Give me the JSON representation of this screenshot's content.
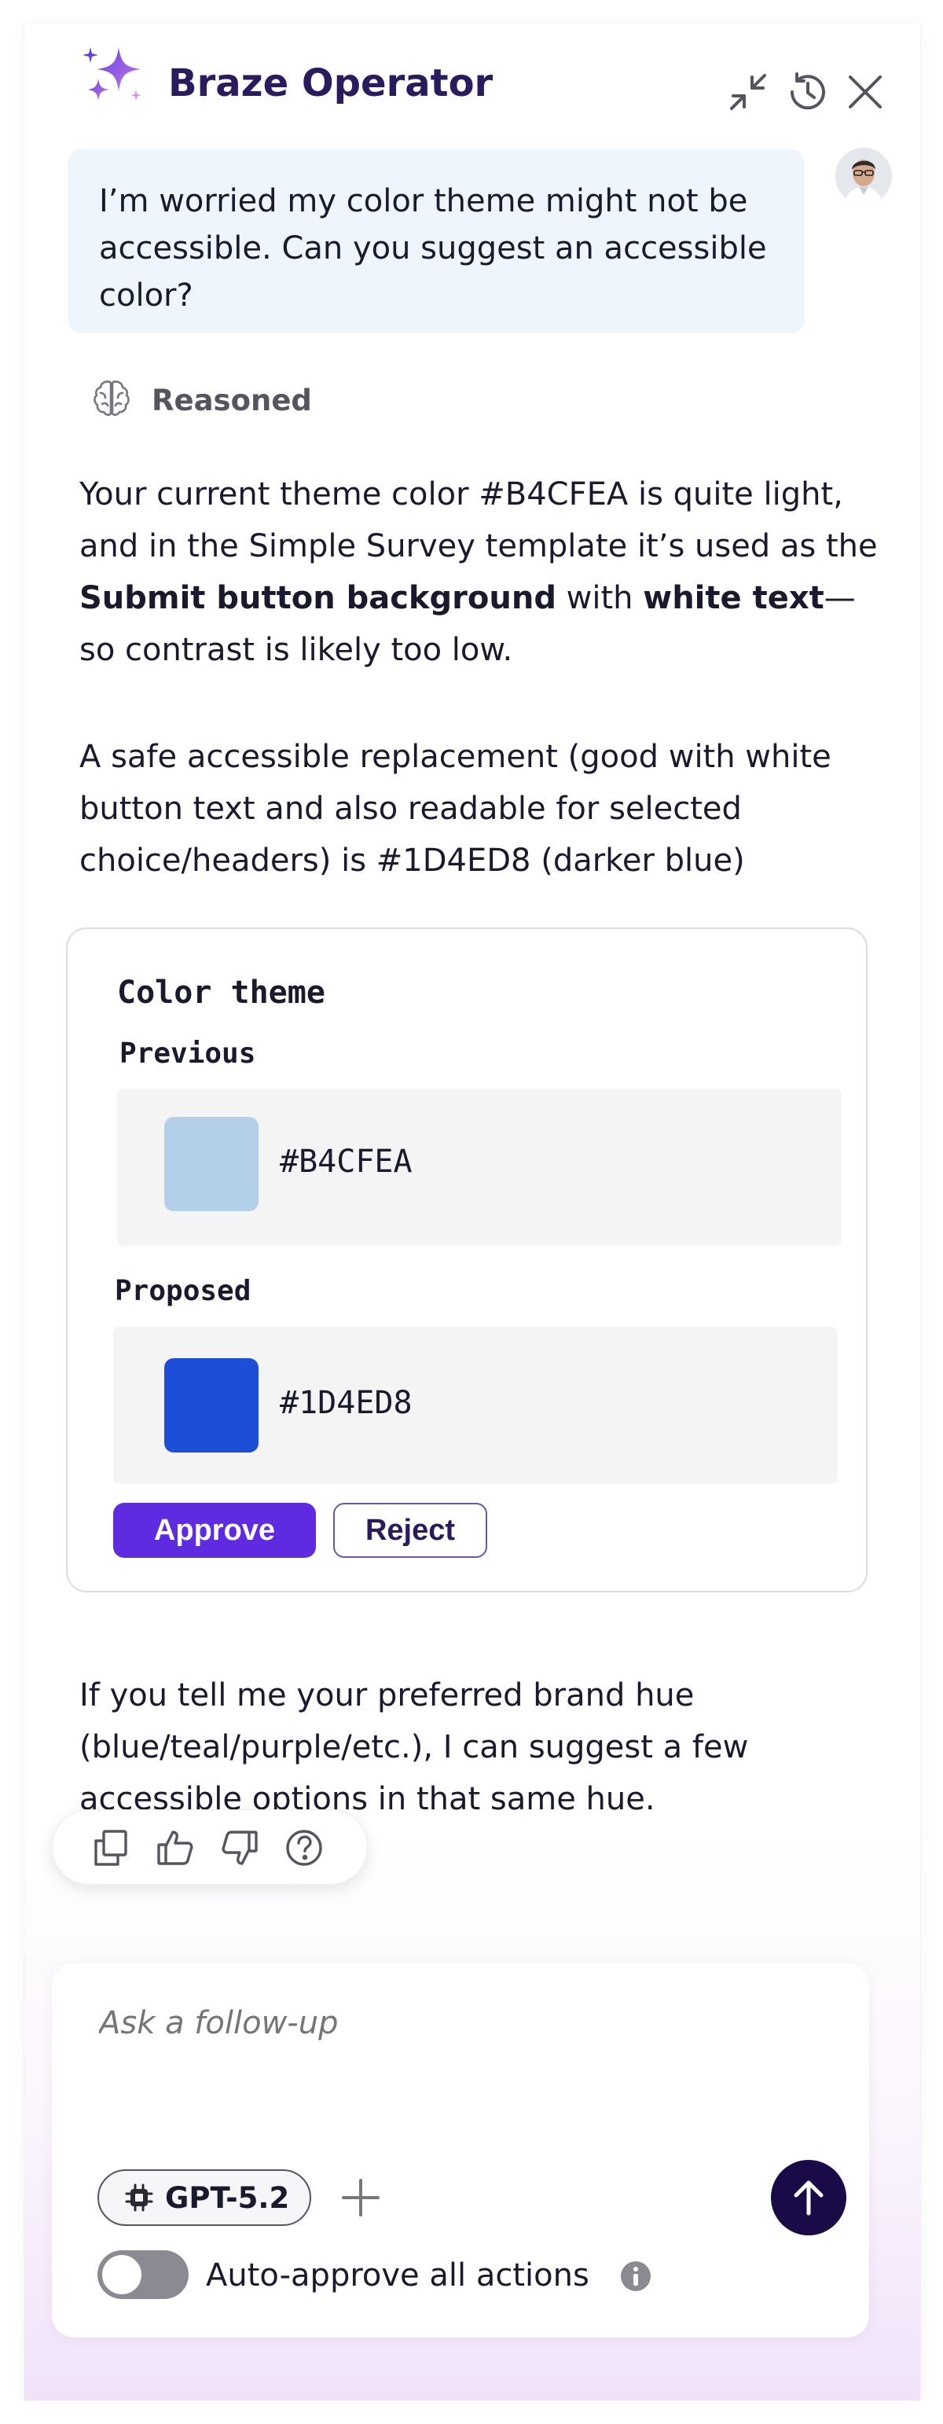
{
  "header": {
    "title": "Braze Operator",
    "icons": [
      "sparkle-icon",
      "minimize-icon",
      "history-icon",
      "close-icon"
    ],
    "brand_color": "#6a3fe0"
  },
  "user_message": {
    "text": "I’m worried my color theme might not be accessible. Can you suggest an accessible color?"
  },
  "reasoning": {
    "label": "Reasoned"
  },
  "response": {
    "p1_start": "Your current theme color #B4CFEA is quite light, and in the Simple Survey template it’s used as the ",
    "p1_bold1": "Submit button background",
    "p1_mid": " with ",
    "p1_bold2": "white text",
    "p1_end": "—so contrast is likely too low.",
    "p2": "A safe accessible replacement (good with white button text and also readable for selected choice/headers) is #1D4ED8 (darker blue)",
    "p3": "If you tell me your preferred brand hue (blue/teal/purple/etc.), I can suggest a few accessible options in that same hue."
  },
  "card": {
    "title": "Color theme",
    "previous_label": "Previous",
    "previous_hex": "#B4CFEA",
    "previous_color": "#B4CFEA",
    "proposed_label": "Proposed",
    "proposed_hex": "#1D4ED8",
    "proposed_color": "#1D4ED8",
    "approve_label": "Approve",
    "reject_label": "Reject"
  },
  "feedback": {
    "icons": [
      "copy-icon",
      "thumbs-up-icon",
      "thumbs-down-icon",
      "help-icon"
    ]
  },
  "composer": {
    "placeholder": "Ask a follow-up",
    "model": "GPT-5.2",
    "auto_approve_label": "Auto-approve all actions",
    "auto_approve_enabled": false
  }
}
